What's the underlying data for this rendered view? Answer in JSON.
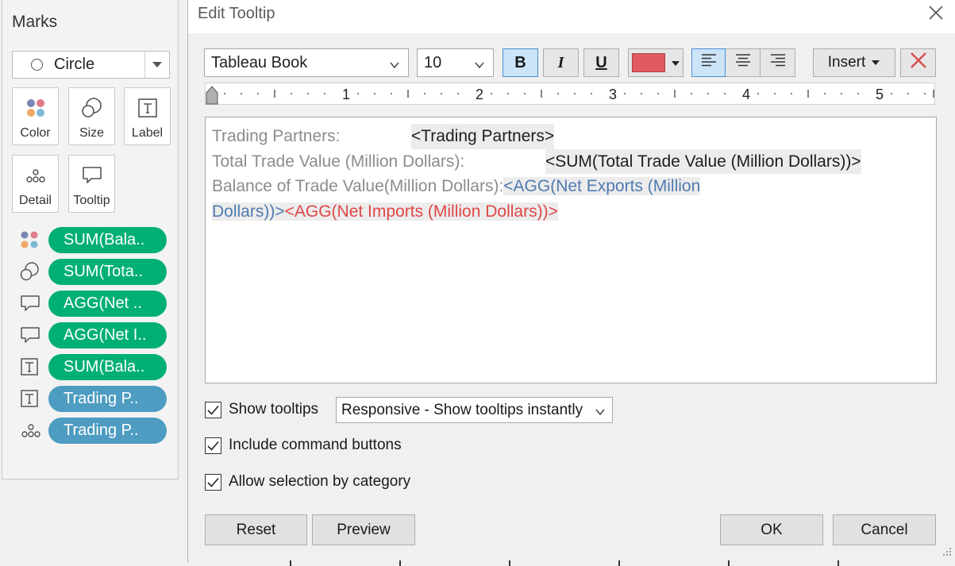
{
  "marks": {
    "title": "Marks",
    "mark_type": "Circle",
    "tiles": [
      {
        "label": "Color",
        "icon": "color-icon"
      },
      {
        "label": "Size",
        "icon": "size-icon"
      },
      {
        "label": "Label",
        "icon": "label-icon"
      },
      {
        "label": "Detail",
        "icon": "detail-icon"
      },
      {
        "label": "Tooltip",
        "icon": "tooltip-icon"
      }
    ],
    "pills": [
      {
        "label": "SUM(Bala..",
        "icon": "color-icon",
        "color": "#00b073"
      },
      {
        "label": "SUM(Tota..",
        "icon": "size-icon",
        "color": "#00b073"
      },
      {
        "label": "AGG(Net ..",
        "icon": "tooltip-icon",
        "color": "#00b073"
      },
      {
        "label": "AGG(Net I..",
        "icon": "tooltip-icon",
        "color": "#00b073"
      },
      {
        "label": "SUM(Bala..",
        "icon": "label-icon",
        "color": "#00b073"
      },
      {
        "label": "Trading P..",
        "icon": "label-icon",
        "color": "#4e9cc1"
      },
      {
        "label": "Trading P..",
        "icon": "detail-icon",
        "color": "#4e9cc1"
      }
    ]
  },
  "dialog": {
    "title": "Edit Tooltip",
    "toolbar": {
      "font": "Tableau Book",
      "size": "10",
      "bold": "B",
      "italic": "I",
      "underline": "U",
      "font_color": "#e05a5f",
      "insert": "Insert"
    },
    "ruler_numbers": [
      "1",
      "2",
      "3",
      "4",
      "5"
    ],
    "editor": {
      "line1_label": "Trading Partners:",
      "line1_field": "<Trading Partners>",
      "line2_label": "Total Trade Value (Million Dollars):",
      "line2_field": "<SUM(Total Trade Value (Million Dollars))>",
      "line3_label": "Balance of Trade Value(Million Dollars):",
      "line3_field_a": "<AGG(Net Exports (Million",
      "line4_field_a": "Dollars))>",
      "line4_field_b": "<AGG(Net Imports (Million Dollars))>"
    },
    "show_tooltips": {
      "label": "Show tooltips",
      "checked": true
    },
    "tooltip_mode": "Responsive - Show tooltips instantly",
    "include_command_buttons": {
      "label": "Include command buttons",
      "checked": true
    },
    "allow_selection": {
      "label": "Allow selection by category",
      "checked": true
    },
    "buttons": {
      "reset": "Reset",
      "preview": "Preview",
      "ok": "OK",
      "cancel": "Cancel"
    }
  }
}
